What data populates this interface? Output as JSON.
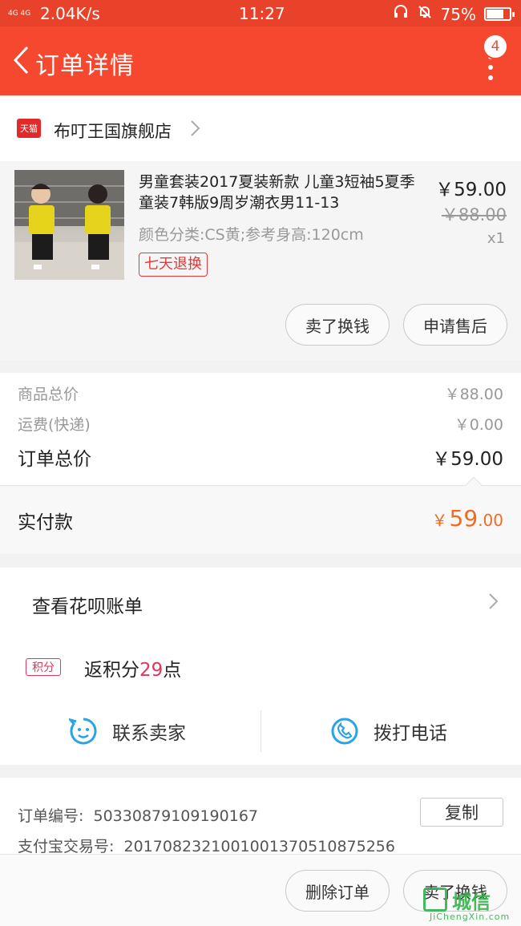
{
  "status_bar": {
    "network": "4G 4G",
    "speed": "2.04K/s",
    "time": "11:27",
    "battery": "75%",
    "battery_level": 0.75
  },
  "nav": {
    "title": "订单详情",
    "badge_count": "4"
  },
  "store": {
    "platform_icon": "天猫",
    "name": "布叮王国旗舰店"
  },
  "product": {
    "title": "男童套装2017夏装新款 儿童3短袖5夏季童装7韩版9周岁潮衣男11-13",
    "sku": "颜色分类:CS黄;参考身高:120cm",
    "tag": "七天退换",
    "price": "￥59.00",
    "original_price": "￥88.00",
    "quantity": "x1",
    "actions": [
      "卖了换钱",
      "申请售后"
    ]
  },
  "summary": {
    "goods_total_label": "商品总价",
    "goods_total_value": "￥88.00",
    "shipping_label": "运费(快递)",
    "shipping_value": "￥0.00",
    "order_total_label": "订单总价",
    "order_total_value": "￥59.00",
    "paid_label": "实付款",
    "paid_currency": "￥",
    "paid_integer": "59",
    "paid_decimal": ".00"
  },
  "huabei": {
    "label": "查看花呗账单"
  },
  "points": {
    "icon_label": "积分",
    "prefix": "返积分",
    "amount": "29",
    "suffix": "点"
  },
  "contact": {
    "seller_label": "联系卖家",
    "call_label": "拨打电话"
  },
  "order_info": {
    "order_no_label": "订单编号:",
    "order_no": "50330879109190167",
    "alipay_label": "支付宝交易号:",
    "alipay_no": "2017082321001001370510875256",
    "copy_label": "复制"
  },
  "bottom_actions": [
    "删除订单",
    "卖了换钱"
  ],
  "watermark": {
    "text": "城信",
    "sub": "JiChengXin.com"
  },
  "colors": {
    "nav_bg": "#f5482f",
    "status_bg": "#e8432a",
    "accent_red": "#e23a3a",
    "paid_orange": "#f56a1f",
    "contact_blue": "#29a3e6"
  }
}
